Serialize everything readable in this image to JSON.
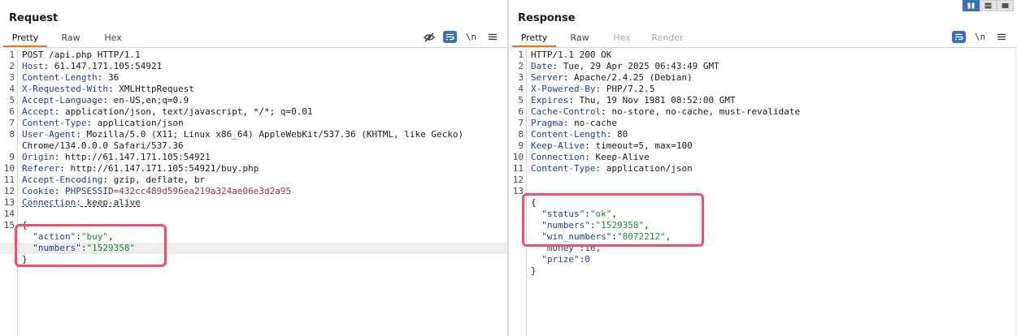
{
  "request": {
    "title": "Request",
    "tabs": [
      "Pretty",
      "Raw",
      "Hex"
    ],
    "icons": [
      "eye-slash-icon",
      "wrap-icon",
      "newline-icon",
      "menu-icon"
    ],
    "newline_glyph": "\\n",
    "lines": [
      {
        "n": "1",
        "text": "POST /api.php HTTP/1.1"
      },
      {
        "n": "2",
        "name": "Host",
        "value": " 61.147.171.105:54921"
      },
      {
        "n": "3",
        "name": "Content-Length",
        "value": " 36"
      },
      {
        "n": "4",
        "name": "X-Requested-With",
        "value": " XMLHttpRequest"
      },
      {
        "n": "5",
        "name": "Accept-Language",
        "value": " en-US,en;q=0.9"
      },
      {
        "n": "6",
        "name": "Accept",
        "value": " application/json, text/javascript, */*; q=0.01"
      },
      {
        "n": "7",
        "name": "Content-Type",
        "value": " application/json"
      },
      {
        "n": "8",
        "name": "User-Agent",
        "value": " Mozilla/5.0 (X11; Linux x86_64) AppleWebKit/537.36 (KHTML, like Gecko)"
      },
      {
        "n": "",
        "text": "Chrome/134.0.0.0 Safari/537.36"
      },
      {
        "n": "9",
        "name": "Origin",
        "value": " http://61.147.171.105:54921"
      },
      {
        "n": "10",
        "name": "Referer",
        "value": " http://61.147.171.105:54921/buy.php"
      },
      {
        "n": "11",
        "name": "Accept-Encoding",
        "value": " gzip, deflate, br"
      },
      {
        "n": "12",
        "cookie": true,
        "name": "Cookie",
        "sep": ": ",
        "ckey": "PHPSESSID",
        "cval": "=432cc489d596ea219a324ae06e3d2a95"
      },
      {
        "n": "13",
        "name": "Connection",
        "value": " keep-alive",
        "underline": true
      },
      {
        "n": "14",
        "text": ""
      },
      {
        "n": "15",
        "text": "{"
      },
      {
        "n": "",
        "indent": "  ",
        "key": "\"action\"",
        "colon": ":",
        "str": "\"buy\"",
        "tail": ","
      },
      {
        "n": "",
        "indent": "  ",
        "key": "\"numbers\"",
        "colon": ":",
        "str": "\"1529358\"",
        "tail": "",
        "hl": true
      },
      {
        "n": "",
        "text": "}"
      }
    ]
  },
  "response": {
    "title": "Response",
    "tabs": [
      "Pretty",
      "Raw",
      "Hex",
      "Render"
    ],
    "icons": [
      "wrap-icon",
      "newline-icon",
      "menu-icon"
    ],
    "newline_glyph": "\\n",
    "lines": [
      {
        "n": "1",
        "text": "HTTP/1.1 200 OK"
      },
      {
        "n": "2",
        "name": "Date",
        "value": " Tue, 29 Apr 2025 06:43:49 GMT"
      },
      {
        "n": "3",
        "name": "Server",
        "value": " Apache/2.4.25 (Debian)"
      },
      {
        "n": "4",
        "name": "X-Powered-By",
        "value": " PHP/7.2.5"
      },
      {
        "n": "5",
        "name": "Expires",
        "value": " Thu, 19 Nov 1981 08:52:00 GMT"
      },
      {
        "n": "6",
        "name": "Cache-Control",
        "value": " no-store, no-cache, must-revalidate"
      },
      {
        "n": "7",
        "name": "Pragma",
        "value": " no-cache"
      },
      {
        "n": "8",
        "name": "Content-Length",
        "value": " 80"
      },
      {
        "n": "9",
        "name": "Keep-Alive",
        "value": " timeout=5, max=100"
      },
      {
        "n": "10",
        "name": "Connection",
        "value": " Keep-Alive"
      },
      {
        "n": "11",
        "name": "Content-Type",
        "value": " application/json"
      },
      {
        "n": "12",
        "text": ""
      },
      {
        "n": "13",
        "text": ""
      },
      {
        "n": "",
        "text": "{"
      },
      {
        "n": "",
        "indent": "  ",
        "key": "\"status\"",
        "colon": ":",
        "str": "\"ok\"",
        "tail": ","
      },
      {
        "n": "",
        "indent": "  ",
        "key": "\"numbers\"",
        "colon": ":",
        "str": "\"1529358\"",
        "tail": ","
      },
      {
        "n": "",
        "indent": "  ",
        "key": "\"win_numbers\"",
        "colon": ":",
        "str": "\"8072212\"",
        "tail": ","
      },
      {
        "n": "",
        "indent": "  ",
        "key": "\"money\"",
        "colon": ":",
        "num": "16",
        "tail": ","
      },
      {
        "n": "",
        "indent": "  ",
        "key": "\"prize\"",
        "colon": ":",
        "num": "0",
        "tail": ""
      },
      {
        "n": "",
        "text": "}"
      }
    ]
  },
  "layout_toggle": [
    "split-columns-icon",
    "split-rows-icon",
    "single-pane-icon"
  ],
  "colors": {
    "accent": "#e8752c",
    "highlight_box": "#f0506e",
    "button_blue": "#3b6fb6"
  }
}
